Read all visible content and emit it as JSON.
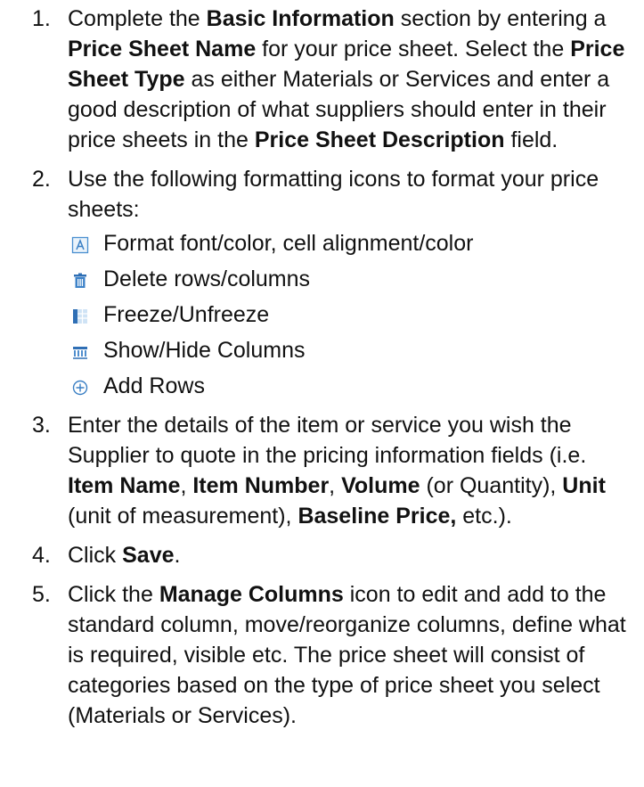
{
  "steps": [
    {
      "num": "1.",
      "parts": [
        [
          "Complete the ",
          false
        ],
        [
          "Basic Information",
          true
        ],
        [
          " section by entering a ",
          false
        ],
        [
          "Price Sheet Name",
          true
        ],
        [
          " for your price sheet. Select the ",
          false
        ],
        [
          "Price Sheet Type",
          true
        ],
        [
          " as either Materials or Services and enter a good description of what suppliers should enter in their price sheets in the ",
          false
        ],
        [
          "Price Sheet Description",
          true
        ],
        [
          " field.",
          false
        ]
      ]
    },
    {
      "num": "2.",
      "parts": [
        [
          "Use the following formatting icons to format your price sheets:",
          false
        ]
      ],
      "icons": [
        {
          "icon": "format-font-icon",
          "label": "Format font/color, cell alignment/color"
        },
        {
          "icon": "trash-icon",
          "label": "Delete rows/columns"
        },
        {
          "icon": "freeze-icon",
          "label": "Freeze/Unfreeze"
        },
        {
          "icon": "show-hide-columns-icon",
          "label": "Show/Hide Columns"
        },
        {
          "icon": "add-circle-icon",
          "label": "Add Rows"
        }
      ]
    },
    {
      "num": "3.",
      "parts": [
        [
          "Enter the details of the item or service you wish the Supplier to quote in the pricing information fields (i.e. ",
          false
        ],
        [
          "Item Name",
          true
        ],
        [
          ", ",
          false
        ],
        [
          "Item Number",
          true
        ],
        [
          ", ",
          false
        ],
        [
          "Volume",
          true
        ],
        [
          " (or Quantity), ",
          false
        ],
        [
          "Unit",
          true
        ],
        [
          " (unit of measurement), ",
          false
        ],
        [
          "Baseline Price,",
          true
        ],
        [
          " etc.).",
          false
        ]
      ]
    },
    {
      "num": "4.",
      "parts": [
        [
          "Click ",
          false
        ],
        [
          "Save",
          true
        ],
        [
          ".",
          false
        ]
      ]
    },
    {
      "num": "5.",
      "parts": [
        [
          "Click the ",
          false
        ],
        [
          "Manage Columns",
          true
        ],
        [
          " icon to edit and add to the standard column, move/reorganize columns, define what is required, visible etc. The price sheet will consist of categories based on the type of price sheet you select (Materials or Services).",
          false
        ]
      ]
    }
  ]
}
